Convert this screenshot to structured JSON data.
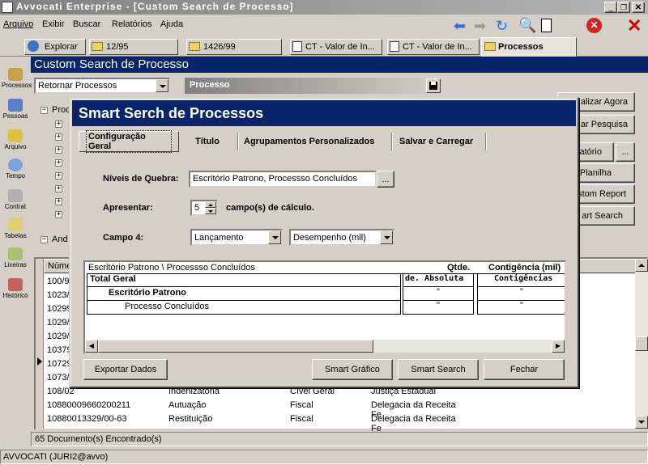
{
  "window": {
    "title": "Avvocati Enterprise - [Custom Search de Processo]"
  },
  "menu": [
    "Arquivo",
    "Exibir",
    "Buscar",
    "Relatórios",
    "Ajuda"
  ],
  "doc_tabs": [
    "Explorar",
    "12/95",
    "1426/99",
    "CT - Valor de In...",
    "CT - Valor de In...",
    "Processos"
  ],
  "sidebar": [
    "Processos",
    "Pessoas",
    "Arquivo",
    "Tempo",
    "Contrat",
    "Tabelas",
    "Lixeiras",
    "Histórico"
  ],
  "main": {
    "title": "Custom Search de Processo",
    "selector_value": "Retornar Processos",
    "section_header": "Processo",
    "tree_root": "Proc",
    "tree_bottom": "And",
    "right_buttons": [
      "alizar Agora",
      "ar Pesquisa",
      "atório",
      "...",
      "Planilha",
      "stom Report",
      "art Search"
    ],
    "grid_header": "Núme",
    "grid_numbers": [
      "100/9",
      "1023/",
      "10299",
      "1029/",
      "1029/",
      "10379",
      "10729",
      "1073/"
    ],
    "grid_rows": [
      [
        "108/02",
        "Indenizatória",
        "Cível Geral",
        "Justiça Estadual"
      ],
      [
        "10880009660200211",
        "Autuação",
        "Fiscal",
        "Delegacia da Receita Fe"
      ],
      [
        "10880013329/00-63",
        "Restituição",
        "Fiscal",
        "Delegacia da Receita Fe"
      ]
    ],
    "status": "65 Documento(s) Encontrado(s)"
  },
  "statusbar": "AVVOCATI (JURI2@avvo)",
  "dialog": {
    "title": "Smart Serch de Processos",
    "tabs": [
      "Configuração Geral",
      "Título",
      "Agrupamentos Personalizados",
      "Salvar e Carregar"
    ],
    "niveis_label": "Níveis de Quebra:",
    "niveis_value": "Escritório Patrono, Processso Concluídos",
    "browse": "...",
    "apresentar_label": "Apresentar:",
    "apresentar_value": "5",
    "apresentar_suffix": "campo(s) de cálculo.",
    "campo_label": "Campo 4:",
    "campo_value1": "Lançamento",
    "campo_value2": "Desempenho (mil)",
    "preview": {
      "path": "Escritório Patrono \\ Processso Concluídos",
      "col_qtde": "Qtde.",
      "col_contig": "Contigência (mil)",
      "header_sub_1": "de. Absoluta",
      "header_sub_2": "Contigências",
      "rows": [
        {
          "label": "Total Geral",
          "v1": "",
          "v2": ""
        },
        {
          "label": "Escritório Patrono",
          "v1": "\"",
          "v2": "\""
        },
        {
          "label": "Processo Concluídos",
          "v1": "\"",
          "v2": "\""
        }
      ]
    },
    "buttons": {
      "export": "Exportar Dados",
      "grafico": "Smart Gráfico",
      "search": "Smart Search",
      "close": "Fechar"
    }
  },
  "colors": {
    "title_active": "#0a246a",
    "title_inactive": "#808080",
    "dialog_title": "#0a246a",
    "desktop": "#d4d0c8"
  }
}
